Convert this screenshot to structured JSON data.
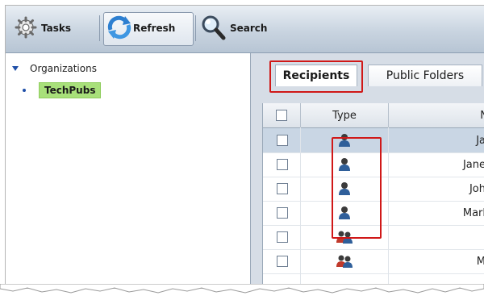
{
  "toolbar": {
    "tasks_label": "Tasks",
    "refresh_label": "Refresh",
    "search_label": "Search"
  },
  "tree": {
    "root_label": "Organizations",
    "selected_label": "TechPubs"
  },
  "tabs": [
    {
      "label": "Recipients",
      "active": true
    },
    {
      "label": "Public Folders",
      "active": false
    }
  ],
  "grid": {
    "columns": [
      "Type",
      "N"
    ],
    "rows": [
      {
        "type_icon": "user-icon",
        "name": "Ja",
        "selected": true
      },
      {
        "type_icon": "user-icon",
        "name": "Jane",
        "selected": false
      },
      {
        "type_icon": "user-icon",
        "name": "Joh",
        "selected": false
      },
      {
        "type_icon": "user-icon",
        "name": "Marl",
        "selected": false
      },
      {
        "type_icon": "group-icon",
        "name": "",
        "selected": false
      },
      {
        "type_icon": "group-icon",
        "name": "M",
        "selected": false
      }
    ]
  },
  "colors": {
    "highlight": "#d01818",
    "selected_node": "#a8e07a",
    "selected_row": "#c9d6e4"
  }
}
